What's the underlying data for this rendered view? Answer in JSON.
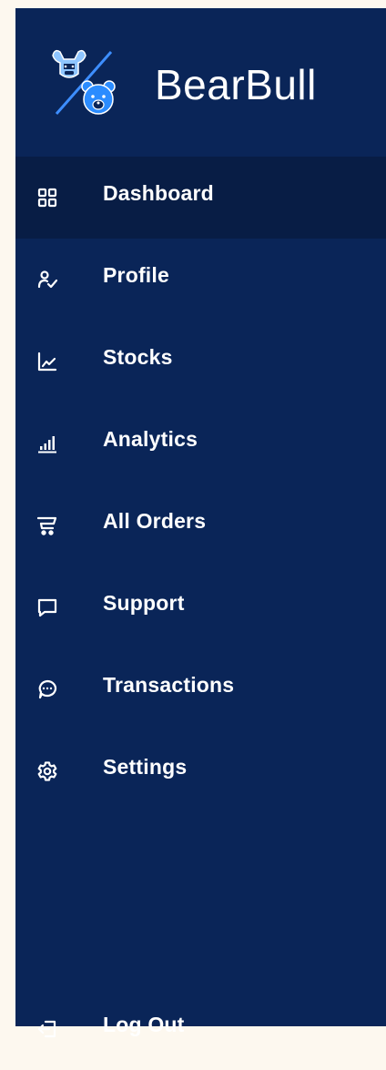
{
  "brand": {
    "name": "BearBull",
    "logo_icon": "bull-bear-logo"
  },
  "nav": {
    "items": [
      {
        "label": "Dashboard",
        "icon": "dashboard-grid-icon",
        "active": true
      },
      {
        "label": "Profile",
        "icon": "user-check-icon",
        "active": false
      },
      {
        "label": "Stocks",
        "icon": "line-chart-icon",
        "active": false
      },
      {
        "label": "Analytics",
        "icon": "bar-chart-icon",
        "active": false
      },
      {
        "label": "All Orders",
        "icon": "cart-icon",
        "active": false
      },
      {
        "label": "Support",
        "icon": "chat-box-icon",
        "active": false
      },
      {
        "label": "Transactions",
        "icon": "message-dots-icon",
        "active": false
      },
      {
        "label": "Settings",
        "icon": "gear-icon",
        "active": false
      }
    ],
    "logout": {
      "label": "Log Out",
      "icon": "logout-icon"
    }
  },
  "colors": {
    "sidebar_bg": "#0a2558",
    "active_bg": "#081d45",
    "page_bg": "#fdf8ef",
    "text": "#ffffff",
    "logo_accent": "#2b8cff"
  }
}
